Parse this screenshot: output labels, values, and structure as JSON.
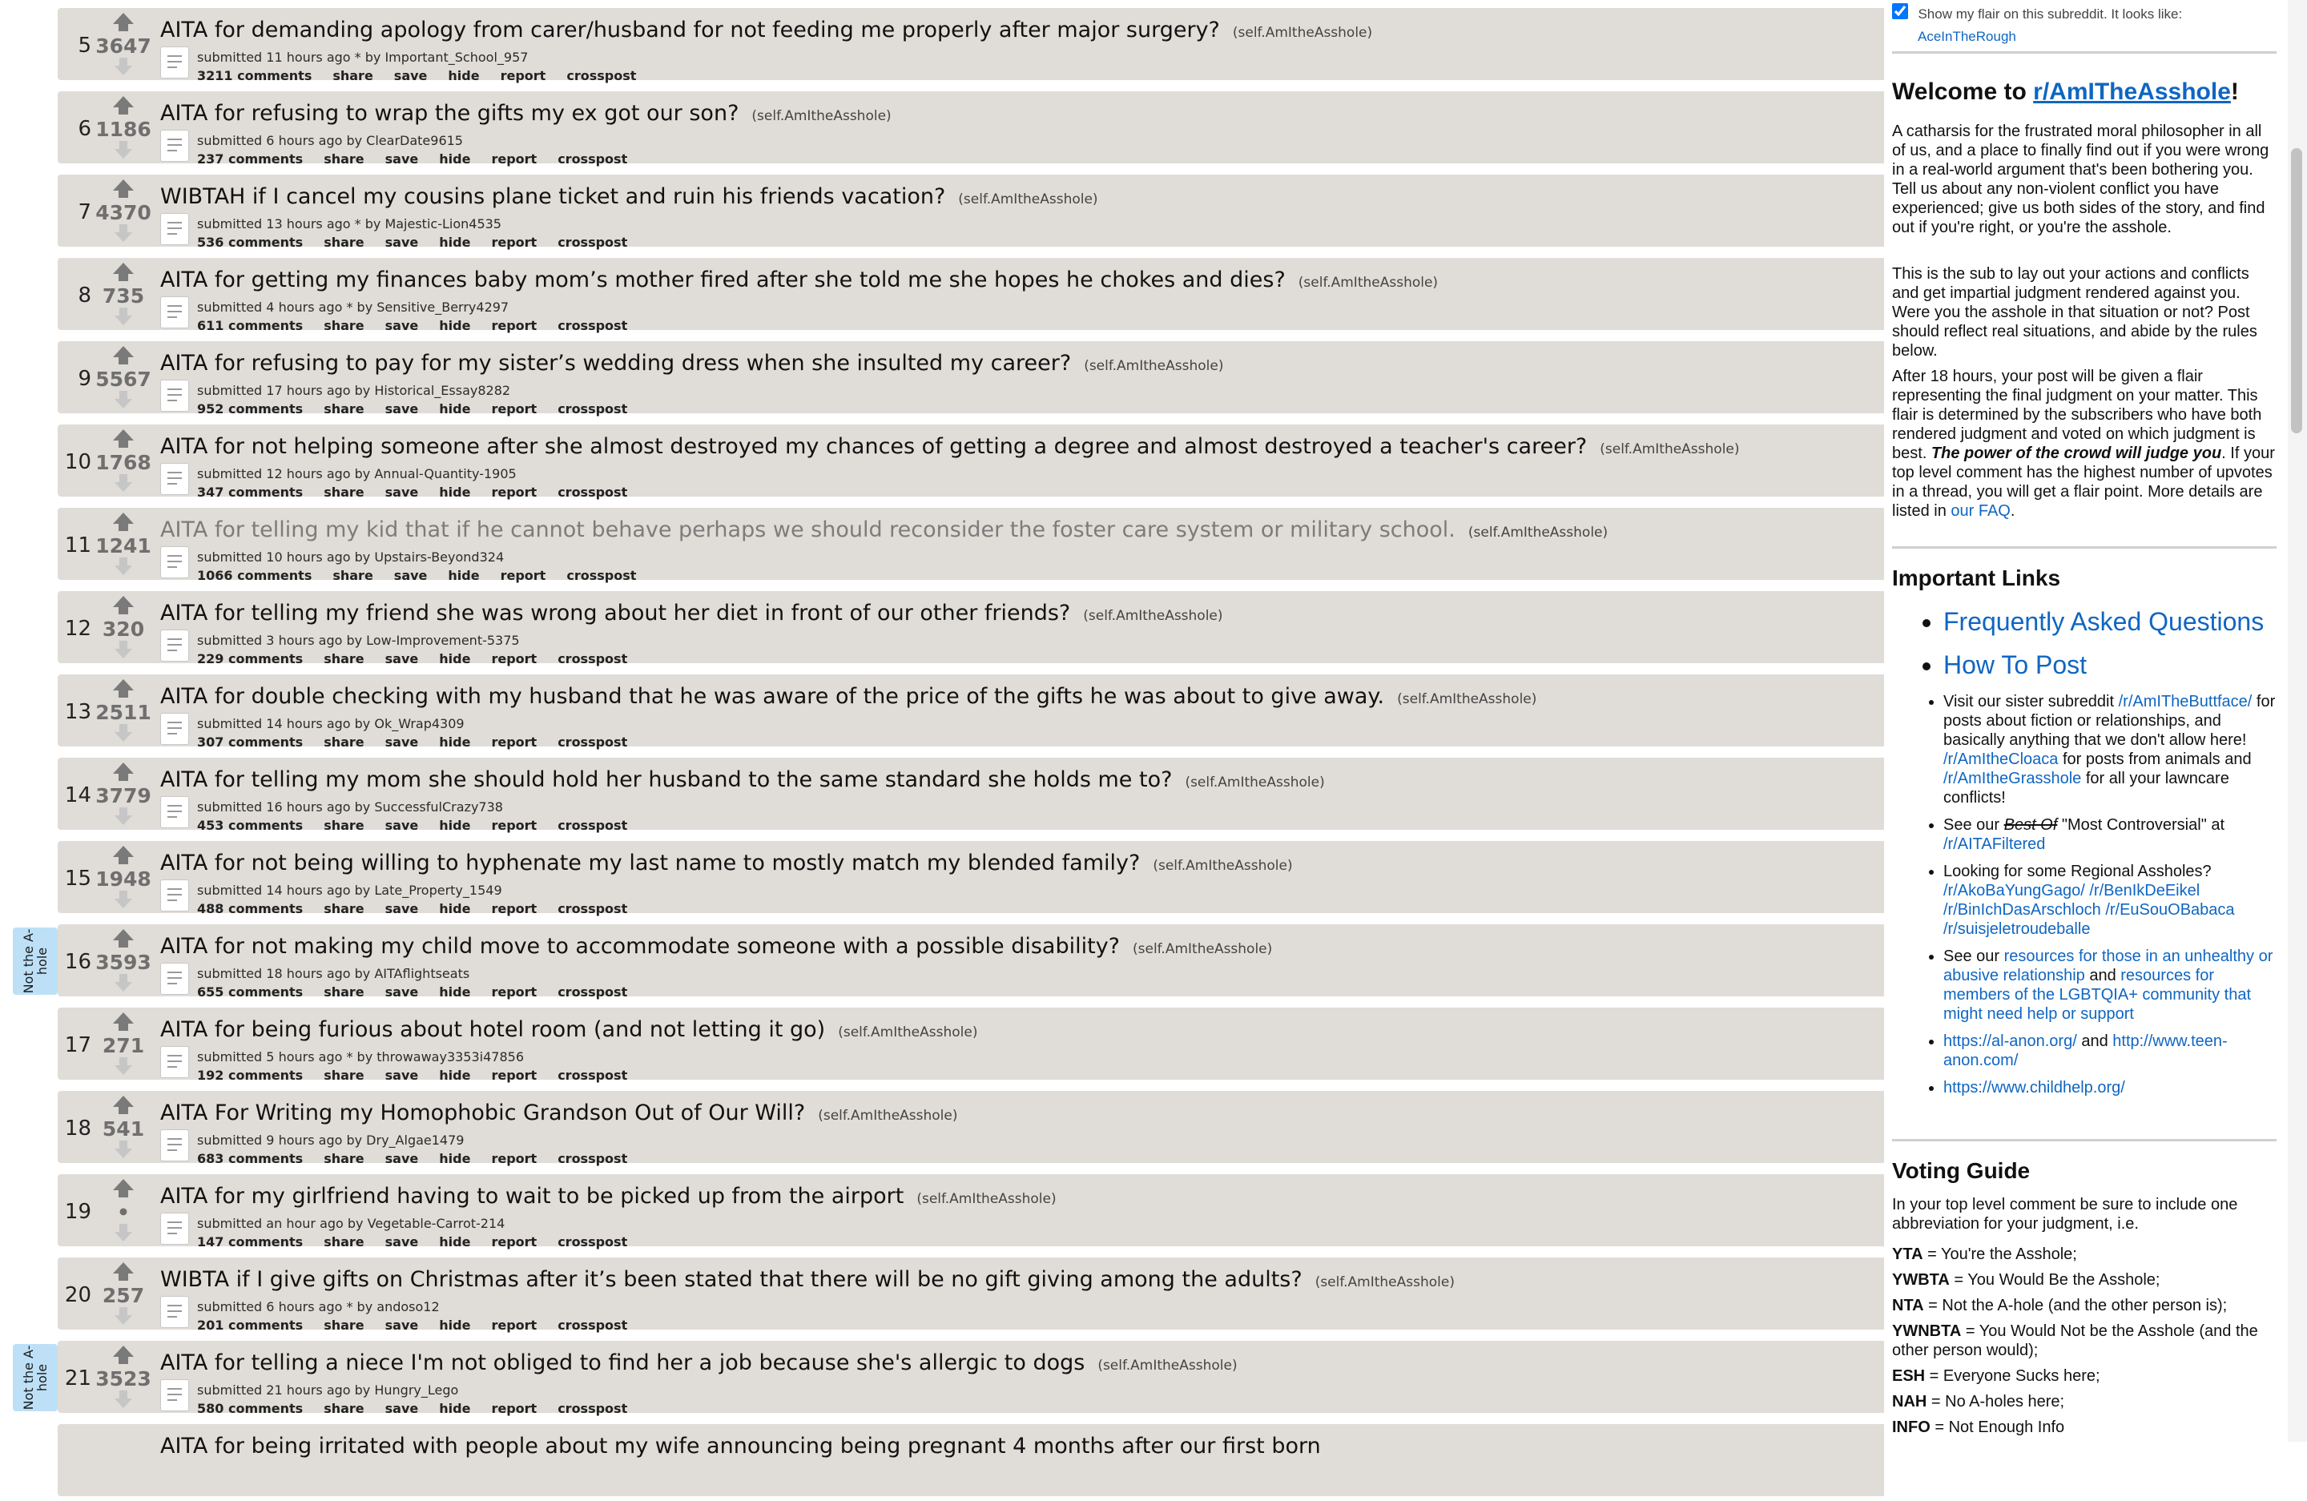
{
  "posts": [
    {
      "rank": "5",
      "score": "3647",
      "title": "AITA for demanding apology from carer/husband for not feeding me properly after major surgery?",
      "domain": "(self.AmItheAsshole)",
      "tagline": "submitted 11 hours ago * by Important_School_957",
      "comments": "3211 comments",
      "visited": false,
      "flair": ""
    },
    {
      "rank": "6",
      "score": "1186",
      "title": "AITA for refusing to wrap the gifts my ex got our son?",
      "domain": "(self.AmItheAsshole)",
      "tagline": "submitted 6 hours ago by ClearDate9615",
      "comments": "237 comments",
      "visited": false,
      "flair": ""
    },
    {
      "rank": "7",
      "score": "4370",
      "title": "WIBTAH if I cancel my cousins plane ticket and ruin his friends vacation?",
      "domain": "(self.AmItheAsshole)",
      "tagline": "submitted 13 hours ago * by Majestic-Lion4535",
      "comments": "536 comments",
      "visited": false,
      "flair": ""
    },
    {
      "rank": "8",
      "score": "735",
      "title": "AITA for getting my finances baby mom’s mother fired after she told me she hopes he chokes and dies?",
      "domain": "(self.AmItheAsshole)",
      "tagline": "submitted 4 hours ago * by Sensitive_Berry4297",
      "comments": "611 comments",
      "visited": false,
      "flair": ""
    },
    {
      "rank": "9",
      "score": "5567",
      "title": "AITA for refusing to pay for my sister’s wedding dress when she insulted my career?",
      "domain": "(self.AmItheAsshole)",
      "tagline": "submitted 17 hours ago by Historical_Essay8282",
      "comments": "952 comments",
      "visited": false,
      "flair": ""
    },
    {
      "rank": "10",
      "score": "1768",
      "title": "AITA for not helping someone after she almost destroyed my chances of getting a degree and almost destroyed a teacher's career?",
      "domain": "(self.AmItheAsshole)",
      "tagline": "submitted 12 hours ago by Annual-Quantity-1905",
      "comments": "347 comments",
      "visited": false,
      "flair": ""
    },
    {
      "rank": "11",
      "score": "1241",
      "title": "AITA for telling my kid that if he cannot behave perhaps we should reconsider the foster care system or military school.",
      "domain": "(self.AmItheAsshole)",
      "tagline": "submitted 10 hours ago by Upstairs-Beyond324",
      "comments": "1066 comments",
      "visited": true,
      "flair": ""
    },
    {
      "rank": "12",
      "score": "320",
      "title": "AITA for telling my friend she was wrong about her diet in front of our other friends?",
      "domain": "(self.AmItheAsshole)",
      "tagline": "submitted 3 hours ago by Low-Improvement-5375",
      "comments": "229 comments",
      "visited": false,
      "flair": ""
    },
    {
      "rank": "13",
      "score": "2511",
      "title": "AITA for double checking with my husband that he was aware of the price of the gifts he was about to give away.",
      "domain": "(self.AmItheAsshole)",
      "tagline": "submitted 14 hours ago by Ok_Wrap4309",
      "comments": "307 comments",
      "visited": false,
      "flair": ""
    },
    {
      "rank": "14",
      "score": "3779",
      "title": "AITA for telling my mom she should hold her husband to the same standard she holds me to?",
      "domain": "(self.AmItheAsshole)",
      "tagline": "submitted 16 hours ago by SuccessfulCrazy738",
      "comments": "453 comments",
      "visited": false,
      "flair": ""
    },
    {
      "rank": "15",
      "score": "1948",
      "title": "AITA for not being willing to hyphenate my last name to mostly match my blended family?",
      "domain": "(self.AmItheAsshole)",
      "tagline": "submitted 14 hours ago by Late_Property_1549",
      "comments": "488 comments",
      "visited": false,
      "flair": ""
    },
    {
      "rank": "16",
      "score": "3593",
      "title": "AITA for not making my child move to accommodate someone with a possible disability?",
      "domain": "(self.AmItheAsshole)",
      "tagline": "submitted 18 hours ago by AITAflightseats",
      "comments": "655 comments",
      "visited": false,
      "flair": "Not the A-hole"
    },
    {
      "rank": "17",
      "score": "271",
      "title": "AITA for being furious about hotel room (and not letting it go)",
      "domain": "(self.AmItheAsshole)",
      "tagline": "submitted 5 hours ago * by throwaway3353i47856",
      "comments": "192 comments",
      "visited": false,
      "flair": ""
    },
    {
      "rank": "18",
      "score": "541",
      "title": "AITA For Writing my Homophobic Grandson Out of Our Will?",
      "domain": "(self.AmItheAsshole)",
      "tagline": "submitted 9 hours ago by Dry_Algae1479",
      "comments": "683 comments",
      "visited": false,
      "flair": ""
    },
    {
      "rank": "19",
      "score": "•",
      "title": "AITA for my girlfriend having to wait to be picked up from the airport",
      "domain": "(self.AmItheAsshole)",
      "tagline": "submitted an hour ago by Vegetable-Carrot-214",
      "comments": "147 comments",
      "visited": false,
      "flair": ""
    },
    {
      "rank": "20",
      "score": "257",
      "title": "WIBTA if I give gifts on Christmas after it’s been stated that there will be no gift giving among the adults?",
      "domain": "(self.AmItheAsshole)",
      "tagline": "submitted 6 hours ago * by andoso12",
      "comments": "201 comments",
      "visited": false,
      "flair": ""
    },
    {
      "rank": "21",
      "score": "3523",
      "title": "AITA for telling a niece I'm not obliged to find her a job because she's allergic to dogs",
      "domain": "(self.AmItheAsshole)",
      "tagline": "submitted 21 hours ago by Hungry_Lego",
      "comments": "580 comments",
      "visited": false,
      "flair": "Not the A-hole"
    },
    {
      "rank": "",
      "score": "",
      "title": "AITA for being irritated with people about my wife announcing being pregnant 4 months after our first born",
      "domain": "",
      "tagline": "",
      "comments": "",
      "visited": false,
      "flair": ""
    }
  ],
  "post_buttons": [
    "share",
    "save",
    "hide",
    "report",
    "crosspost"
  ],
  "sidebar": {
    "flair_label": "Show my flair on this subreddit. It looks like:",
    "flair_checked": true,
    "flair_name": "AceInTheRough",
    "welcome_prefix": "Welcome to ",
    "welcome_link": "r/AmITheAsshole",
    "welcome_suffix": "!",
    "para1": "A catharsis for the frustrated moral philosopher in all of us, and a place to finally find out if you were wrong in a real-world argument that's been bothering you. Tell us about any non-violent conflict you have experienced; give us both sides of the story, and find out if you're right, or you're the asshole.",
    "para2": "This is the sub to lay out your actions and conflicts and get impartial judgment rendered against you. Were you the asshole in that situation or not? Post should reflect real situations, and abide by the rules below.",
    "para3a": "After 18 hours, your post will be given a flair representing the final judgment on your matter. This flair is determined by the subscribers who have both rendered judgment and voted on which judgment is best. ",
    "para3b": "The power of the crowd will judge you",
    "para3c": ". If your top level comment has the highest number of upvotes in a thread, you will get a flair point. More details are listed in ",
    "para3d": "our FAQ",
    "para3e": ".",
    "links_heading": "Important Links",
    "faq_link": "Frequently Asked Questions",
    "howto_link": "How To Post",
    "sister_1": "Visit our sister subreddit ",
    "sister_l1": "/r/AmITheButtface/",
    "sister_2": " for posts about fiction or relationships, and basically anything that we don't allow here! ",
    "sister_l2": "/r/AmItheCloaca",
    "sister_3": " for posts from animals and ",
    "sister_l3": "/r/AmItheGrasshole",
    "sister_4": " for all your lawncare conflicts!",
    "see_1": "See our ",
    "see_strike": "Best Of",
    "see_2": " \"Most Controversial\" at ",
    "see_link": "/r/AITAFiltered",
    "regional_text": "Looking for some Regional Assholes?",
    "regional_l1": "/r/AkoBaYungGago/",
    "regional_l2": "/r/BenIkDeEikel",
    "regional_l3": "/r/BinIchDasArschloch",
    "regional_l4": "/r/EuSouOBabaca",
    "regional_l5": "/r/suisjeletroudeballe",
    "res_1": "See our ",
    "res_l1": "resources for those in an unhealthy or abusive relationship",
    "res_2": " and ",
    "res_l2": "resources for members of the LGBTQIA+ community that might need help or support",
    "alanon": "https://al-anon.org/",
    "and": " and ",
    "teenanon": "http://www.teen-anon.com/",
    "childhelp": "https://www.childhelp.org/",
    "voting_heading": "Voting Guide",
    "voting_intro": "In your top level comment be sure to include one abbreviation for your judgment, i.e.",
    "verdicts": [
      {
        "abbr": "YTA",
        "text": " = You're the Asshole;"
      },
      {
        "abbr": "YWBTA",
        "text": " = You Would Be the Asshole;"
      },
      {
        "abbr": "NTA",
        "text": " = Not the A-hole (and the other person is);"
      },
      {
        "abbr": "YWNBTA",
        "text": " = You Would Not be the Asshole (and the other person would);"
      },
      {
        "abbr": "ESH",
        "text": " = Everyone Sucks here;"
      },
      {
        "abbr": "NAH",
        "text": " = No A-holes here;"
      },
      {
        "abbr": "INFO",
        "text": " = Not Enough Info"
      }
    ]
  },
  "colors": {
    "card": "#e0dcd7",
    "flair": "#bde0f7",
    "link": "#0f66c2",
    "visited": "#7c7c7c"
  }
}
